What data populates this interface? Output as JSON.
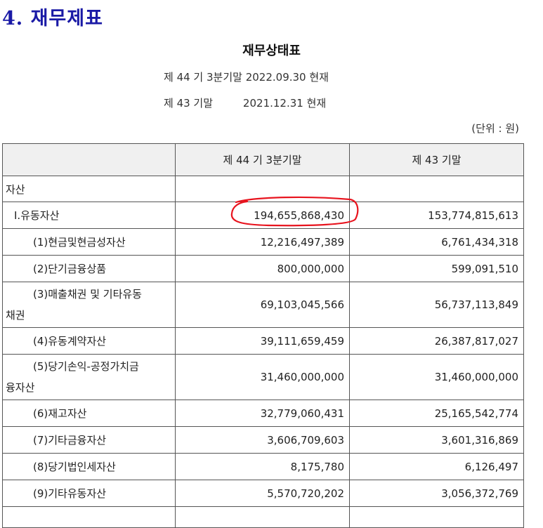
{
  "section_title": "4. 재무제표",
  "document_title": "재무상태표",
  "periods": [
    "제 44 기 3분기말 2022.09.30 현재",
    "제 43 기말         2021.12.31 현재"
  ],
  "unit": "(단위 : 원)",
  "annotation_color": "#e8141e",
  "table": {
    "headers": [
      "",
      "제 44 기 3분기말",
      "제 43 기말"
    ],
    "rows": [
      {
        "label": "자산",
        "current": "",
        "prior": ""
      },
      {
        "label": "Ⅰ.유동자산",
        "current": "194,655,868,430",
        "prior": "153,774,815,613"
      },
      {
        "label": "(1)현금및현금성자산",
        "current": "12,216,497,389",
        "prior": "6,761,434,318"
      },
      {
        "label": "(2)단기금융상품",
        "current": "800,000,000",
        "prior": "599,091,510"
      },
      {
        "label_line1": "(3)매출채권 및 기타유동",
        "label_line2": "채권",
        "current": "69,103,045,566",
        "prior": "56,737,113,849"
      },
      {
        "label": "(4)유동계약자산",
        "current": "39,111,659,459",
        "prior": "26,387,817,027"
      },
      {
        "label_line1": "(5)당기손익-공정가치금",
        "label_line2": "융자산",
        "current": "31,460,000,000",
        "prior": "31,460,000,000"
      },
      {
        "label": "(6)재고자산",
        "current": "32,779,060,431",
        "prior": "25,165,542,774"
      },
      {
        "label": "(7)기타금융자산",
        "current": "3,606,709,603",
        "prior": "3,601,316,869"
      },
      {
        "label": "(8)당기법인세자산",
        "current": "8,175,780",
        "prior": "6,126,497"
      },
      {
        "label": "(9)기타유동자산",
        "current": "5,570,720,202",
        "prior": "3,056,372,769"
      }
    ]
  }
}
